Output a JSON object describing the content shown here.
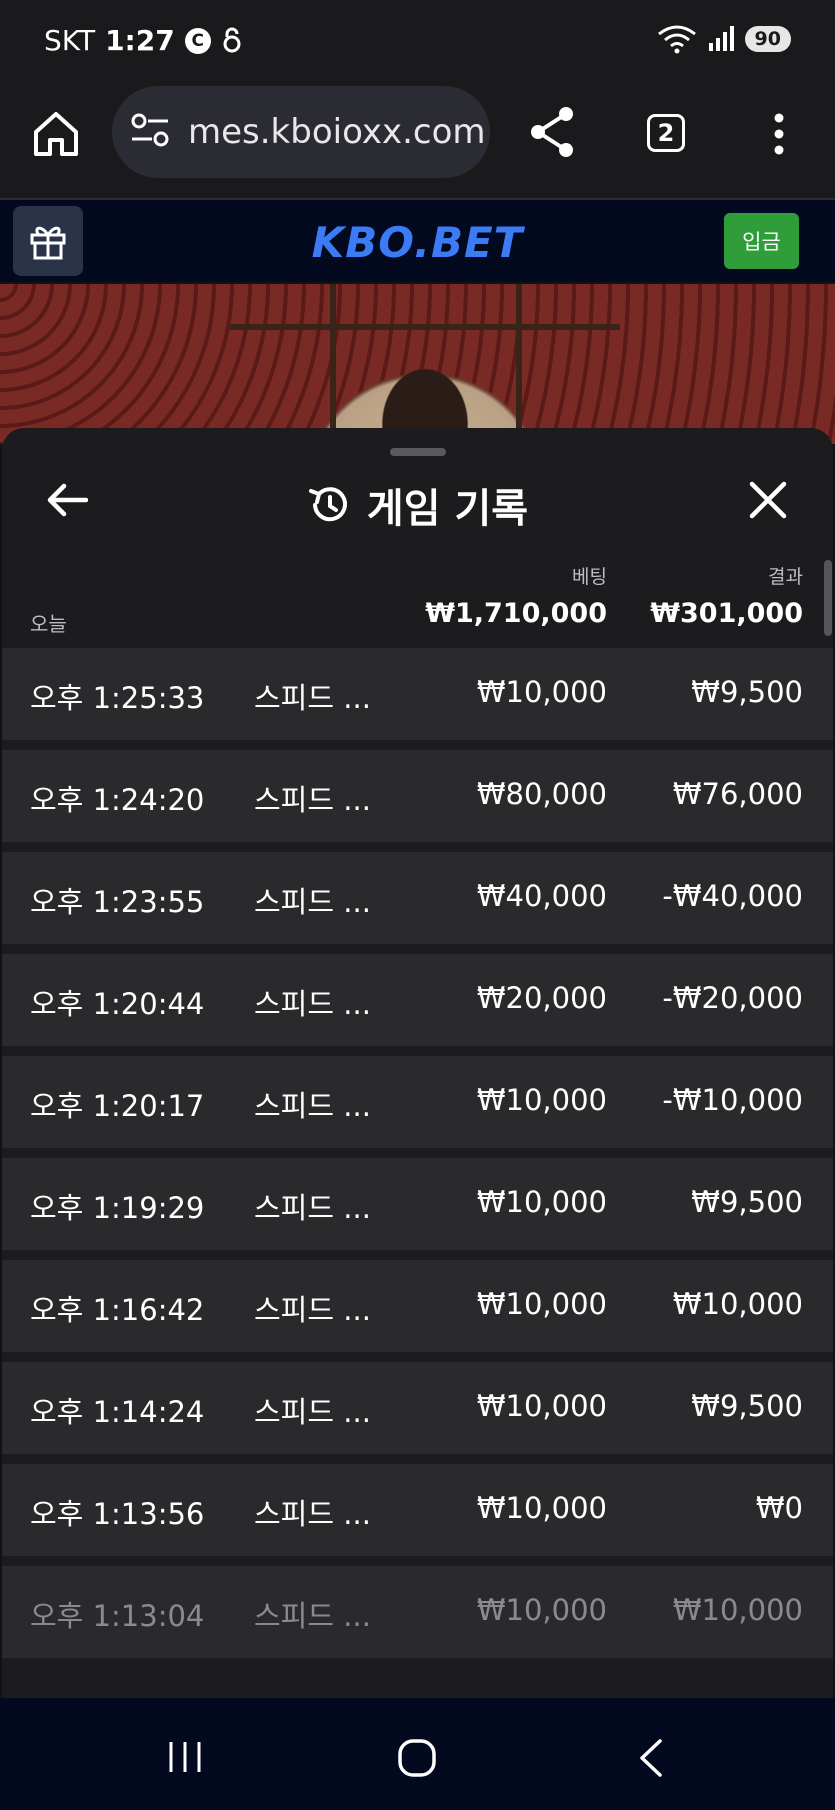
{
  "status_bar": {
    "carrier": "SKT",
    "time": "1:27",
    "badge_c": "C",
    "battery": "90"
  },
  "browser": {
    "url": "mes.kboioxx.com",
    "tab_count": "2"
  },
  "site": {
    "logo": "KBO.BET",
    "deposit_label": "입금"
  },
  "sheet": {
    "title": "게임 기록",
    "bet_label": "베팅",
    "result_label": "결과",
    "today_label": "오늘",
    "total_bet": "₩1,710,000",
    "total_result": "₩301,000"
  },
  "records": [
    {
      "time": "오후 1:25:33",
      "game": "스피드 ...",
      "bet": "₩10,000",
      "result": "₩9,500"
    },
    {
      "time": "오후 1:24:20",
      "game": "스피드 ...",
      "bet": "₩80,000",
      "result": "₩76,000"
    },
    {
      "time": "오후 1:23:55",
      "game": "스피드 ...",
      "bet": "₩40,000",
      "result": "-₩40,000"
    },
    {
      "time": "오후 1:20:44",
      "game": "스피드 ...",
      "bet": "₩20,000",
      "result": "-₩20,000"
    },
    {
      "time": "오후 1:20:17",
      "game": "스피드 ...",
      "bet": "₩10,000",
      "result": "-₩10,000"
    },
    {
      "time": "오후 1:19:29",
      "game": "스피드 ...",
      "bet": "₩10,000",
      "result": "₩9,500"
    },
    {
      "time": "오후 1:16:42",
      "game": "스피드 ...",
      "bet": "₩10,000",
      "result": "₩10,000"
    },
    {
      "time": "오후 1:14:24",
      "game": "스피드 ...",
      "bet": "₩10,000",
      "result": "₩9,500"
    },
    {
      "time": "오후 1:13:56",
      "game": "스피드 ...",
      "bet": "₩10,000",
      "result": "₩0"
    },
    {
      "time": "오후 1:13:04",
      "game": "스피드 ...",
      "bet": "₩10,000",
      "result": "₩10,000"
    }
  ],
  "colors": {
    "brand_blue": "#3b7cf6",
    "deposit_green": "#2f9e3a",
    "sheet_bg": "#1c1c1e",
    "row_bg": "#2a2a2d"
  }
}
